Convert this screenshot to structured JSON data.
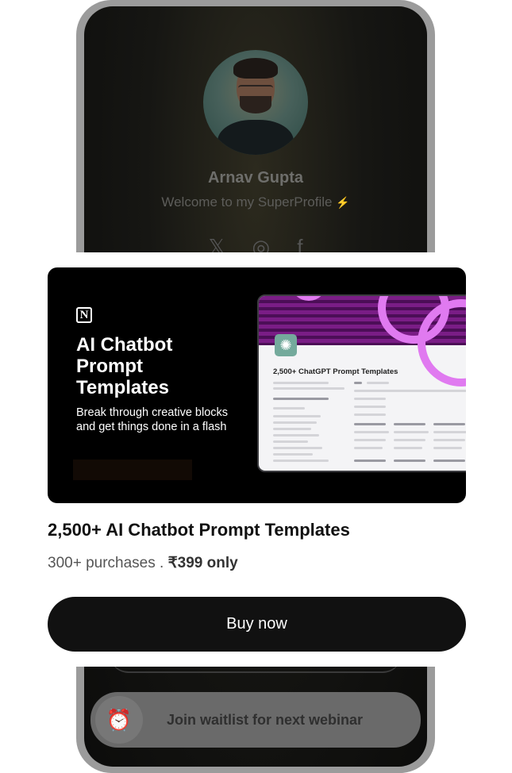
{
  "profile": {
    "name": "Arnav Gupta",
    "tagline": "Welcome to my SuperProfile",
    "tagline_icon": "lightning-icon",
    "social_icons": [
      "x-icon",
      "instagram-icon",
      "facebook-icon"
    ]
  },
  "product": {
    "banner": {
      "logo_icon": "notion-logo-icon",
      "title": "AI Chatbot Prompt Templates",
      "subtitle": "Break through creative blocks and get things done in a flash",
      "mockup_title": "2,500+ ChatGPT Prompt Templates"
    },
    "title": "2,500+ AI Chatbot Prompt Templates",
    "purchases": "300+ purchases .",
    "price": "₹399 only",
    "buy_label": "Buy now"
  },
  "waitlist": {
    "icon": "alarm-clock-icon",
    "label": "Join waitlist for next webinar"
  },
  "colors": {
    "buy_button_bg": "#111111",
    "banner_bg": "#000000",
    "mockup_accent": "#e07af0"
  }
}
